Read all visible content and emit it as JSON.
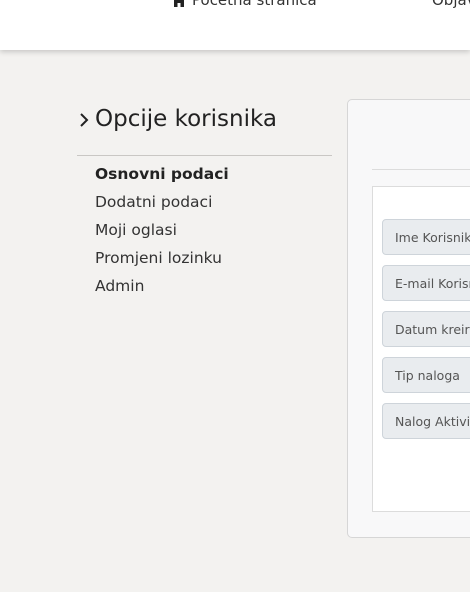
{
  "nav": {
    "home_label": "Početna stranica",
    "ads_label": "Objav"
  },
  "sidebar": {
    "title": "Opcije korisnika",
    "items": [
      {
        "label": "Osnovni podaci",
        "active": true
      },
      {
        "label": "Dodatni podaci",
        "active": false
      },
      {
        "label": "Moji oglasi",
        "active": false
      },
      {
        "label": "Promjeni lozinku",
        "active": false
      },
      {
        "label": "Admin",
        "active": false
      }
    ]
  },
  "form": {
    "fields": [
      {
        "label": "Ime Korisnika"
      },
      {
        "label": "E-mail Korisnika"
      },
      {
        "label": "Datum kreiranja"
      },
      {
        "label": "Tip naloga"
      },
      {
        "label": "Nalog Aktiviran"
      }
    ]
  }
}
